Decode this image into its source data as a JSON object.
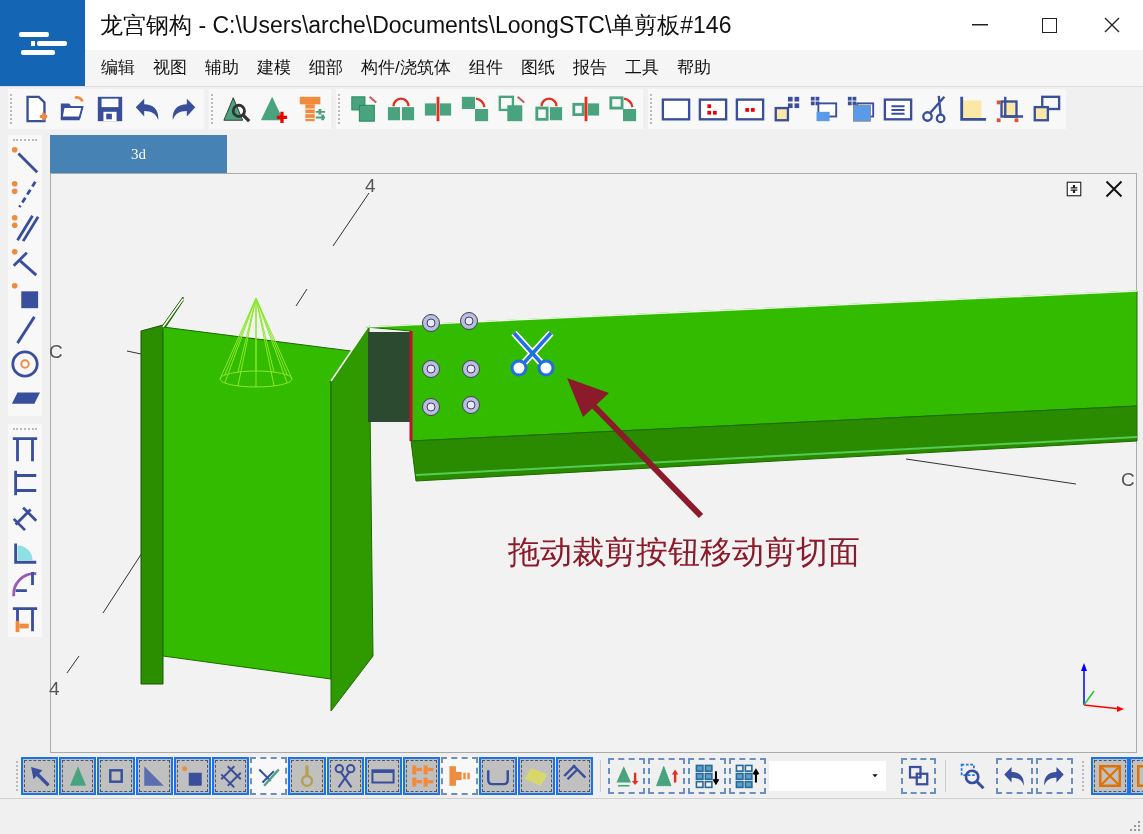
{
  "window": {
    "title": "龙宫钢构 - C:\\Users\\arche\\Documents\\LoongSTC\\单剪板#146"
  },
  "menu": [
    "编辑",
    "视图",
    "辅助",
    "建模",
    "细部",
    "构件/浇筑体",
    "组件",
    "图纸",
    "报告",
    "工具",
    "帮助"
  ],
  "tabs": [
    {
      "label": "3d",
      "selected": true
    }
  ],
  "viewport": {
    "grid_labels": [
      "4",
      "C",
      "C",
      "4"
    ],
    "annotation": "拖动裁剪按钮移动剪切面"
  },
  "bottom_toolbar": {
    "tools": [
      {
        "pressed": true
      },
      {
        "pressed": true
      },
      {
        "pressed": true
      },
      {
        "pressed": true
      },
      {
        "pressed": true
      },
      {
        "pressed": true
      },
      {
        "pressed": false
      },
      {
        "pressed": true
      },
      {
        "pressed": true
      },
      {
        "pressed": true
      },
      {
        "pressed": true
      },
      {
        "pressed": false
      },
      {
        "pressed": true
      },
      {
        "pressed": true
      },
      {
        "pressed": true
      }
    ],
    "end_tools": [
      {
        "pressed": true
      },
      {
        "pressed": true
      }
    ]
  }
}
